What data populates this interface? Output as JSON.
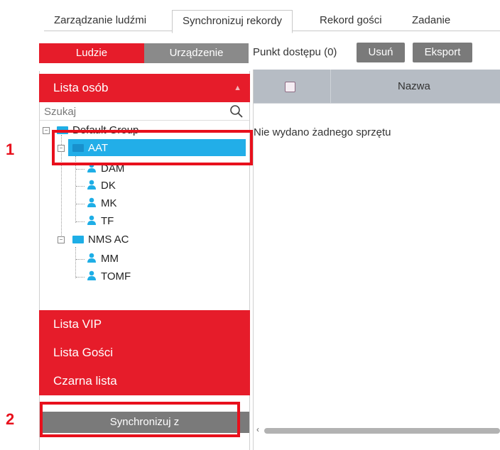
{
  "tabs": [
    {
      "label": "Zarządzanie ludźmi"
    },
    {
      "label": "Synchronizuj rekordy"
    },
    {
      "label": "Rekord gości"
    },
    {
      "label": "Zadanie"
    }
  ],
  "segment": {
    "people_label": "Ludzie",
    "device_label": "Urządzenie"
  },
  "lists": {
    "people_list": "Lista osób",
    "vip_list": "Lista VIP",
    "guest_list": "Lista Gości",
    "black_list": "Czarna lista"
  },
  "search": {
    "placeholder": "Szukaj"
  },
  "tree": {
    "root": "Default Group",
    "group1": "AAT",
    "group1_members": [
      "DAM",
      "DK",
      "MK",
      "TF"
    ],
    "group2": "NMS AC",
    "group2_members": [
      "MM",
      "TOMF"
    ]
  },
  "sync_button": "Synchronizuj z",
  "access_point": {
    "label": "Punkt dostępu (0)",
    "delete": "Usuń",
    "export": "Eksport"
  },
  "table": {
    "col_name": "Nazwa",
    "empty": "Nie wydano żadnego sprzętu"
  },
  "annotations": {
    "one": "1",
    "two": "2"
  },
  "colors": {
    "accent_red": "#e61c2a",
    "selection_blue": "#22aee8",
    "gray_button": "#7a7a7a"
  },
  "icons": {
    "search": "search-icon",
    "folder": "folder-icon",
    "person": "person-icon",
    "chevron": "chevron-up-icon"
  }
}
